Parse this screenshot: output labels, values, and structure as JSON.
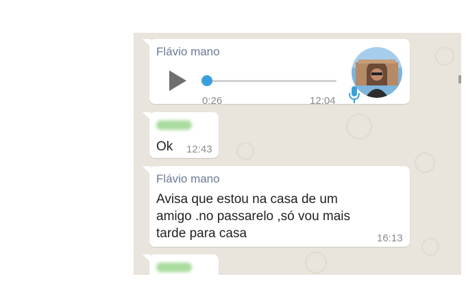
{
  "messages": [
    {
      "type": "voice",
      "sender": "Flávio mano",
      "duration": "0:26",
      "time": "12:04",
      "progress": 0.0
    },
    {
      "type": "text",
      "sender": "",
      "text": "Ok",
      "time": "12:43"
    },
    {
      "type": "text",
      "sender": "Flávio mano",
      "lines": [
        "Avisa que estou na casa de um",
        "amigo .no passarelo ,só vou mais",
        "tarde para casa"
      ],
      "time": "16:13"
    },
    {
      "type": "text",
      "sender": "",
      "text": "",
      "time": ""
    }
  ],
  "colors": {
    "sender_name": "#6a7a94",
    "voice_accent": "#3aa0dc",
    "wallpaper": "#e9e4dc",
    "redacted_name": "#a9dc9e"
  },
  "icons": {
    "play": "play-icon",
    "mic": "microphone-icon",
    "avatar": "contact-avatar"
  }
}
